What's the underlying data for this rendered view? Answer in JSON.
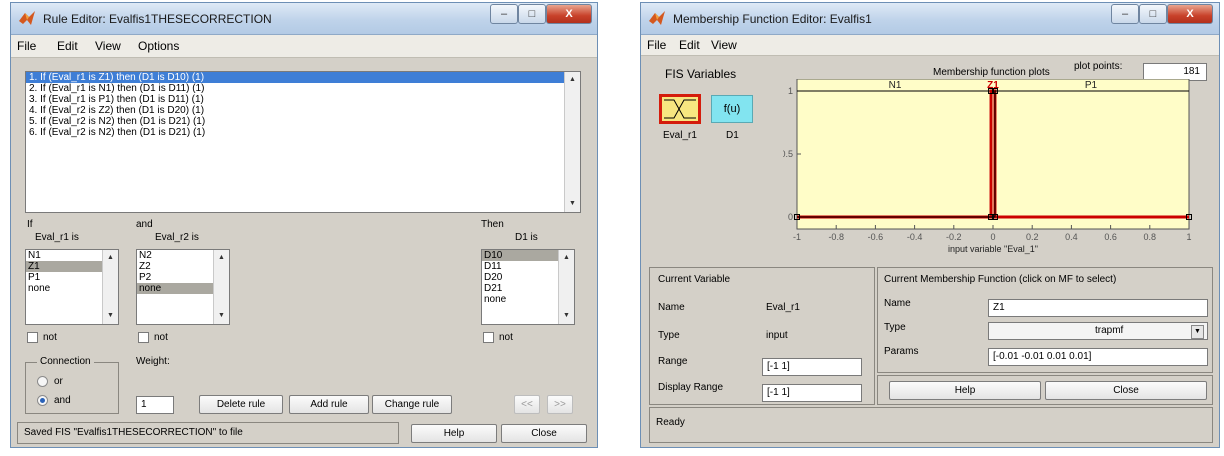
{
  "rule_editor": {
    "title": "Rule Editor: Evalfis1THESECORRECTION",
    "window_buttons": {
      "minimize": "–",
      "maximize": "□",
      "close": "X"
    },
    "menu": [
      "File",
      "Edit",
      "View",
      "Options"
    ],
    "rules": [
      "1. If (Eval_r1 is Z1) then (D1 is D10) (1)",
      "2. If (Eval_r1 is N1) then (D1 is D11) (1)",
      "3. If (Eval_r1 is P1) then (D1 is D11) (1)",
      "4. If (Eval_r2 is Z2) then (D1 is D20) (1)",
      "5. If (Eval_r2 is N2) then (D1 is D21) (1)",
      "6. If (Eval_r2 is N2) then (D1 is D21) (1)"
    ],
    "selected_rule": 0,
    "if_label": "If",
    "and_label": "and",
    "then_label": "Then",
    "input1": {
      "label": "Eval_r1 is",
      "options": [
        "N1",
        "Z1",
        "P1",
        "none"
      ],
      "selected": 1
    },
    "input2": {
      "label": "Eval_r2 is",
      "options": [
        "N2",
        "Z2",
        "P2",
        "none"
      ],
      "selected": 3
    },
    "output": {
      "label": "D1 is",
      "options": [
        "D10",
        "D11",
        "D20",
        "D21",
        "none"
      ],
      "selected": 0
    },
    "not_label": "not",
    "connection": {
      "label": "Connection",
      "options": [
        "or",
        "and"
      ],
      "selected": "and"
    },
    "weight_label": "Weight:",
    "weight_value": "1",
    "buttons": {
      "delete": "Delete rule",
      "add": "Add rule",
      "change": "Change rule",
      "prev": "<<",
      "next": ">>",
      "help": "Help",
      "close": "Close"
    },
    "status": "Saved FIS \"Evalfis1THESECORRECTION\" to file"
  },
  "mf_editor": {
    "title": "Membership Function Editor: Evalfis1",
    "window_buttons": {
      "minimize": "–",
      "maximize": "□",
      "close": "X"
    },
    "menu": [
      "File",
      "Edit",
      "View"
    ],
    "fis_variables_label": "FIS Variables",
    "input_var": "Eval_r1",
    "output_var": "D1",
    "output_block_text": "f(u)",
    "plot_title": "Membership function plots",
    "plot_points_label": "plot points:",
    "plot_points": "181",
    "current_variable": {
      "heading": "Current Variable",
      "name_label": "Name",
      "name": "Eval_r1",
      "type_label": "Type",
      "type": "input",
      "range_label": "Range",
      "range": "[-1 1]",
      "display_range_label": "Display Range",
      "display_range": "[-1 1]"
    },
    "current_mf": {
      "heading": "Current Membership Function (click on MF to select)",
      "name_label": "Name",
      "name": "Z1",
      "type_label": "Type",
      "type": "trapmf",
      "params_label": "Params",
      "params": "[-0.01 -0.01 0.01 0.01]"
    },
    "buttons": {
      "help": "Help",
      "close": "Close"
    },
    "status": "Ready",
    "colors": {
      "plot_bg": "#fffdc8",
      "selected_mf": "#cc0000",
      "mf_line": "#000000",
      "input_block": "#f7e680",
      "output_block": "#82e4f0"
    }
  },
  "chart_data": {
    "type": "line",
    "xlim": [
      -1,
      1
    ],
    "ylim": [
      0,
      1
    ],
    "x_ticks": [
      "-1",
      "-0.8",
      "-0.6",
      "-0.4",
      "-0.2",
      "0",
      "0.2",
      "0.4",
      "0.6",
      "0.8",
      "1"
    ],
    "x_tick_values": [
      -1,
      -0.8,
      -0.6,
      -0.4,
      -0.2,
      0,
      0.2,
      0.4,
      0.6,
      0.8,
      1
    ],
    "y_ticks": [
      "0",
      "0.5",
      "1"
    ],
    "y_tick_values": [
      0,
      0.5,
      1
    ],
    "xlabel": "input variable \"Eval_1\"",
    "series": [
      {
        "name": "N1",
        "label_x": -0.5,
        "points": [
          [
            -1,
            1
          ],
          [
            -0.01,
            1
          ],
          [
            -0.01,
            0
          ],
          [
            1,
            0
          ]
        ],
        "selected": false
      },
      {
        "name": "Z1",
        "label_x": 0,
        "points": [
          [
            -1,
            0
          ],
          [
            -0.01,
            0
          ],
          [
            -0.01,
            1
          ],
          [
            0.01,
            1
          ],
          [
            0.01,
            0
          ],
          [
            1,
            0
          ]
        ],
        "selected": true
      },
      {
        "name": "P1",
        "label_x": 0.5,
        "points": [
          [
            -1,
            0
          ],
          [
            0.01,
            0
          ],
          [
            0.01,
            1
          ],
          [
            1,
            1
          ]
        ],
        "selected": false
      }
    ]
  }
}
